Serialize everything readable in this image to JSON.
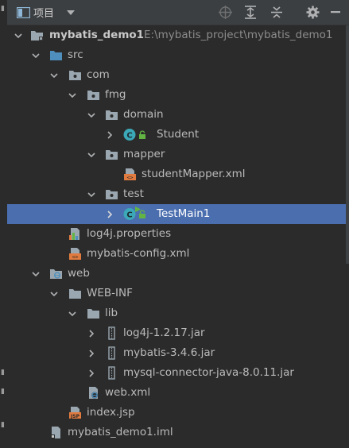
{
  "toolbar": {
    "title": "项目",
    "icons": [
      "view-dropdown-icon",
      "locate-icon",
      "expand-all-icon",
      "collapse-all-icon",
      "settings-icon",
      "hide-icon"
    ]
  },
  "tree": {
    "project_name": "mybatis_demo1",
    "project_path": "E:\\mybatis_project\\mybatis_demo1",
    "items": [
      {
        "label": "src"
      },
      {
        "label": "com"
      },
      {
        "label": "fmg"
      },
      {
        "label": "domain"
      },
      {
        "label": "Student"
      },
      {
        "label": "mapper"
      },
      {
        "label": "studentMapper.xml"
      },
      {
        "label": "test"
      },
      {
        "label": "TestMain1"
      },
      {
        "label": "log4j.properties"
      },
      {
        "label": "mybatis-config.xml"
      },
      {
        "label": "web"
      },
      {
        "label": "WEB-INF"
      },
      {
        "label": "lib"
      },
      {
        "label": "log4j-1.2.17.jar"
      },
      {
        "label": "mybatis-3.4.6.jar"
      },
      {
        "label": "mysql-connector-java-8.0.11.jar"
      },
      {
        "label": "web.xml"
      },
      {
        "label": "index.jsp"
      },
      {
        "label": "mybatis_demo1.iml"
      }
    ]
  },
  "colors": {
    "background": "#2b2b2b",
    "toolbar": "#3c3f41",
    "selection": "#4b6eaf",
    "text": "#bbbbbb",
    "folder": "#9aa7b0",
    "source_folder": "#4e8fbd",
    "class_icon": "#3ba9b8",
    "xml_icon": "#e07a3f"
  }
}
